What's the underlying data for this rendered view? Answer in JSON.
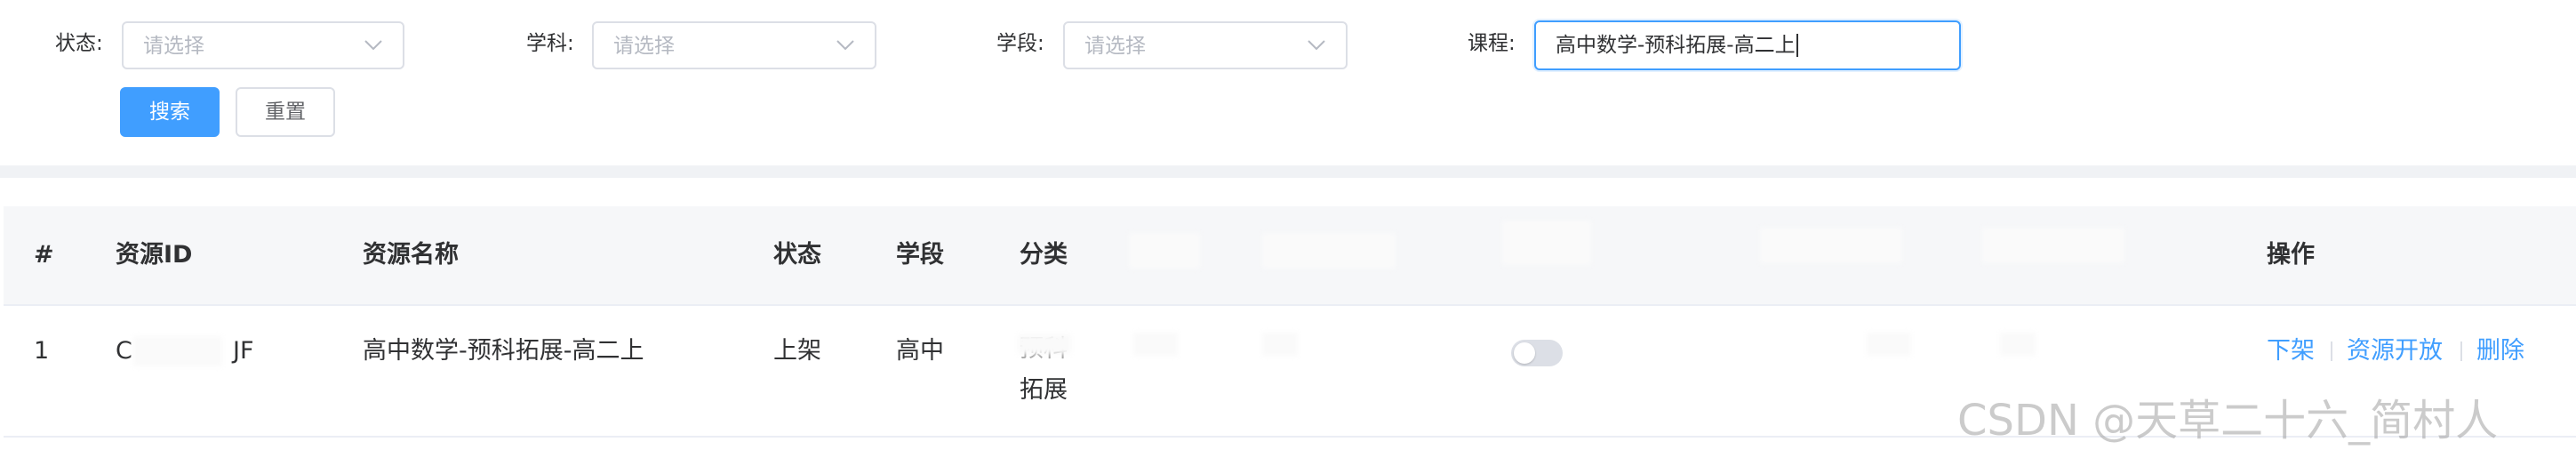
{
  "filters": {
    "status": {
      "label": "状态:",
      "placeholder": "请选择"
    },
    "subject": {
      "label": "学科:",
      "placeholder": "请选择"
    },
    "stage": {
      "label": "学段:",
      "placeholder": "请选择"
    },
    "course": {
      "label": "课程:",
      "value": "高中数学-预科拓展-高二上"
    }
  },
  "buttons": {
    "search": "搜索",
    "reset": "重置"
  },
  "table": {
    "headers": {
      "index": "#",
      "resource_id": "资源ID",
      "resource_name": "资源名称",
      "status": "状态",
      "stage": "学段",
      "category": "分类",
      "actions": "操作"
    },
    "rows": [
      {
        "index": "1",
        "resource_id_prefix": "C",
        "resource_id_suffix": "JF",
        "resource_name": "高中数学-预科拓展-高二上",
        "status": "上架",
        "stage": "高中",
        "category_line1": "预科",
        "category_line2": "拓展",
        "open_switch": false,
        "actions": {
          "offline": "下架",
          "open_resource": "资源开放",
          "delete": "删除"
        }
      }
    ]
  },
  "watermark": "CSDN @天草二十六_简村人",
  "colors": {
    "primary": "#409eff",
    "border": "#dcdfe6",
    "text": "#303133",
    "header_bg": "#f6f7f9"
  }
}
